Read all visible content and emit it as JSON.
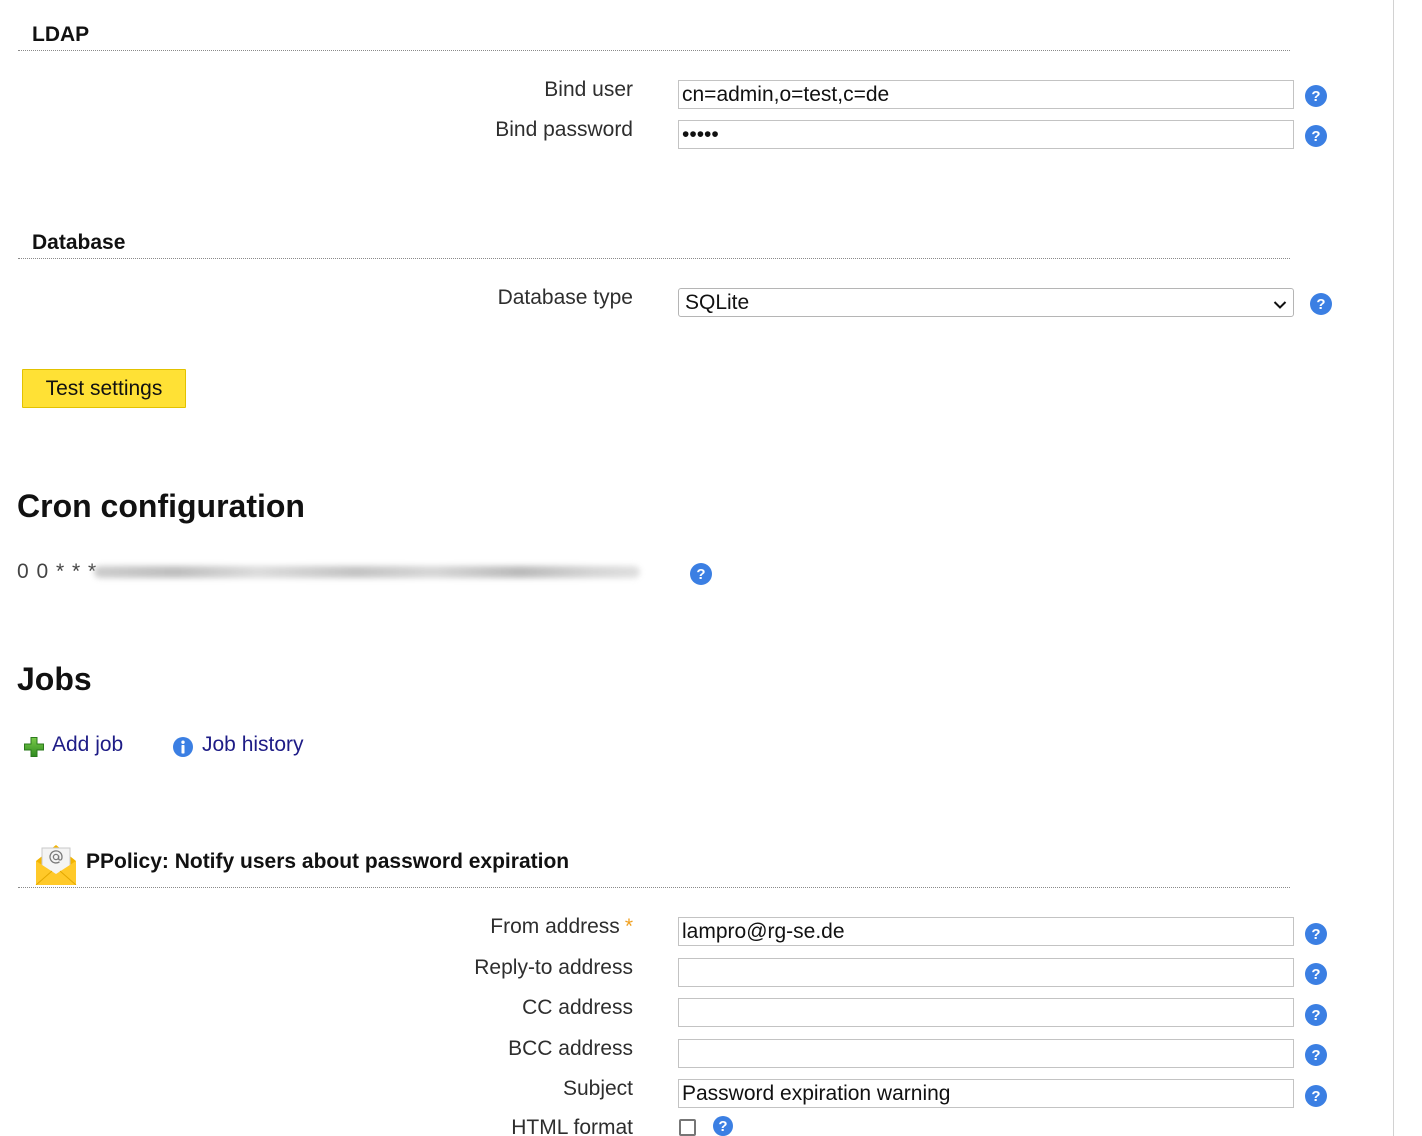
{
  "ldap": {
    "heading": "LDAP",
    "bind_user": {
      "label": "Bind user",
      "value": "cn=admin,o=test,c=de"
    },
    "bind_password": {
      "label": "Bind password",
      "value": "•••••"
    }
  },
  "database": {
    "heading": "Database",
    "type": {
      "label": "Database type",
      "selected": "SQLite"
    }
  },
  "test_button": {
    "label": "Test settings"
  },
  "cron": {
    "heading": "Cron configuration",
    "expression_visible": "0 0 * * *"
  },
  "jobs": {
    "heading": "Jobs",
    "add_job": "Add job",
    "job_history": "Job history"
  },
  "job": {
    "title": "PPolicy: Notify users about password expiration",
    "fields": {
      "from": {
        "label": "From address",
        "required_marker": "*",
        "value": "lampro@rg-se.de"
      },
      "reply_to": {
        "label": "Reply-to address",
        "value": ""
      },
      "cc": {
        "label": "CC address",
        "value": ""
      },
      "bcc": {
        "label": "BCC address",
        "value": ""
      },
      "subject": {
        "label": "Subject",
        "value": "Password expiration warning"
      },
      "html_format": {
        "label": "HTML format",
        "checked": false
      }
    }
  },
  "icons": {
    "help": "help-icon",
    "add_job": "plus-icon",
    "job_history": "info-icon",
    "job_type": "envelope-icon",
    "select": "chevron-down-icon"
  },
  "colors": {
    "help_icon": "#3b7fe3",
    "button_background": "#ffe135",
    "button_border": "#e2c200",
    "link_text": "#1e1c86",
    "required_marker": "#f0a020",
    "plus_icon": "#3f9f2a",
    "envelope": "#ffc929"
  }
}
